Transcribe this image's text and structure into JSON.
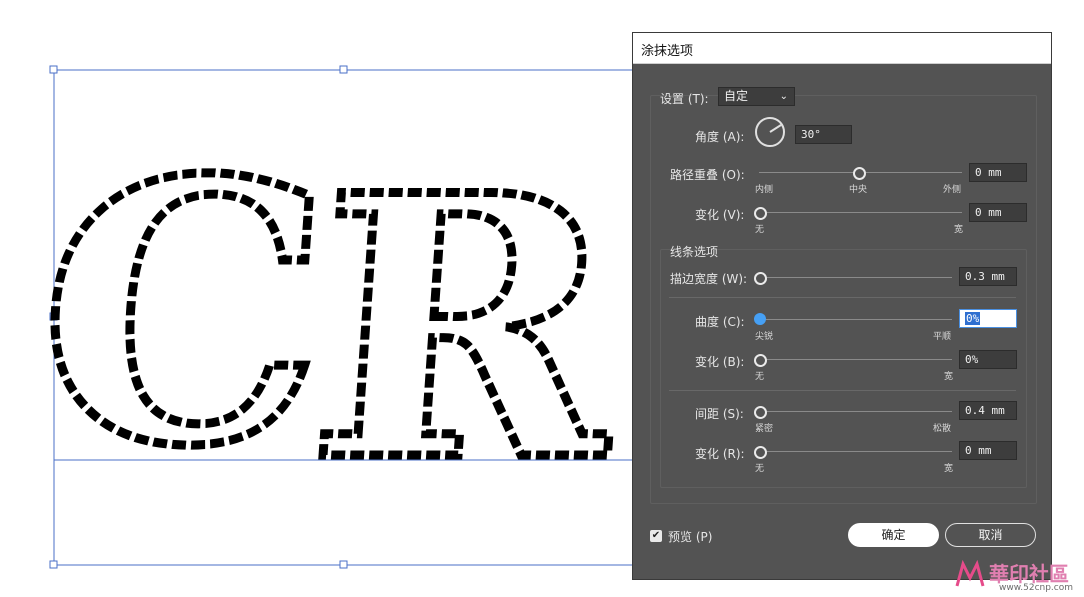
{
  "dialog": {
    "title": "涂抹选项",
    "settings_label": "设置 (T):",
    "preset_value": "自定",
    "angle": {
      "label": "角度 (A):",
      "value": "30°"
    },
    "path_overlap": {
      "label": "路径重叠 (O):",
      "value": "0 mm",
      "min_label": "内侧",
      "mid_label": "中央",
      "max_label": "外侧"
    },
    "overlap_variation": {
      "label": "变化 (V):",
      "value": "0 mm",
      "min_label": "无",
      "max_label": "宽"
    },
    "line_options_title": "线条选项",
    "stroke_width": {
      "label": "描边宽度 (W):",
      "value": "0.3 mm"
    },
    "curviness": {
      "label": "曲度 (C):",
      "value": "0%",
      "min_label": "尖锐",
      "max_label": "平顺"
    },
    "curviness_variation": {
      "label": "变化 (B):",
      "value": "0%",
      "min_label": "无",
      "max_label": "宽"
    },
    "spacing": {
      "label": "间距 (S):",
      "value": "0.4 mm",
      "min_label": "紧密",
      "max_label": "松散"
    },
    "spacing_variation": {
      "label": "变化 (R):",
      "value": "0 mm",
      "min_label": "无",
      "max_label": "宽"
    },
    "preview_label": "预览 (P)",
    "preview_checked": true,
    "ok_label": "确定",
    "cancel_label": "取消"
  },
  "artwork": {
    "letters": "CR"
  },
  "watermark": {
    "brand": "華印社區",
    "url": "www.52cnp.com"
  },
  "colors": {
    "dialog_bg": "#535353",
    "selection_blue": "#4a6fc7",
    "accent_blue": "#46a0f5"
  }
}
